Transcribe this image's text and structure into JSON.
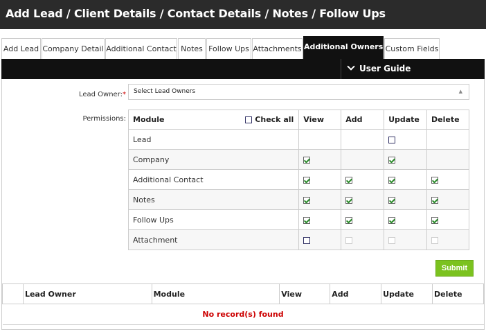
{
  "page_title": "Add Lead / Client Details / Contact Details / Notes / Follow Ups",
  "tabs": [
    {
      "label": "Add Lead"
    },
    {
      "label": "Company Detail"
    },
    {
      "label": "Additional Contact"
    },
    {
      "label": "Notes"
    },
    {
      "label": "Follow Ups"
    },
    {
      "label": "Attachments"
    },
    {
      "label": "Additional Owners",
      "active": true
    },
    {
      "label": "Custom Fields"
    }
  ],
  "user_guide_label": "User Guide",
  "form": {
    "lead_owner_label": "Lead Owner:",
    "required_mark": "*",
    "lead_owner_value": "Select Lead Owners",
    "permissions_label": "Permissions:",
    "check_all_label": "Check all",
    "headers": {
      "module": "Module",
      "view": "View",
      "add": "Add",
      "update": "Update",
      "delete": "Delete"
    },
    "rows": [
      {
        "module": "Lead",
        "view": null,
        "add": null,
        "update": "unchecked",
        "delete": null
      },
      {
        "module": "Company",
        "view": "checked",
        "add": null,
        "update": "checked",
        "delete": null
      },
      {
        "module": "Additional Contact",
        "view": "checked",
        "add": "checked",
        "update": "checked",
        "delete": "checked"
      },
      {
        "module": "Notes",
        "view": "checked",
        "add": "checked",
        "update": "checked",
        "delete": "checked"
      },
      {
        "module": "Follow Ups",
        "view": "checked",
        "add": "checked",
        "update": "checked",
        "delete": "checked"
      },
      {
        "module": "Attachment",
        "view": "unchecked",
        "add": "disabled",
        "update": "disabled",
        "delete": "disabled"
      }
    ],
    "submit_label": "Submit"
  },
  "results": {
    "headers": {
      "lead_owner": "Lead Owner",
      "module": "Module",
      "view": "View",
      "add": "Add",
      "update": "Update",
      "delete": "Delete"
    },
    "empty_message": "No record(s) found"
  },
  "colors": {
    "header_bg": "#2b2b2b",
    "accent_green": "#7bc21f",
    "empty_text": "#cc0000"
  }
}
